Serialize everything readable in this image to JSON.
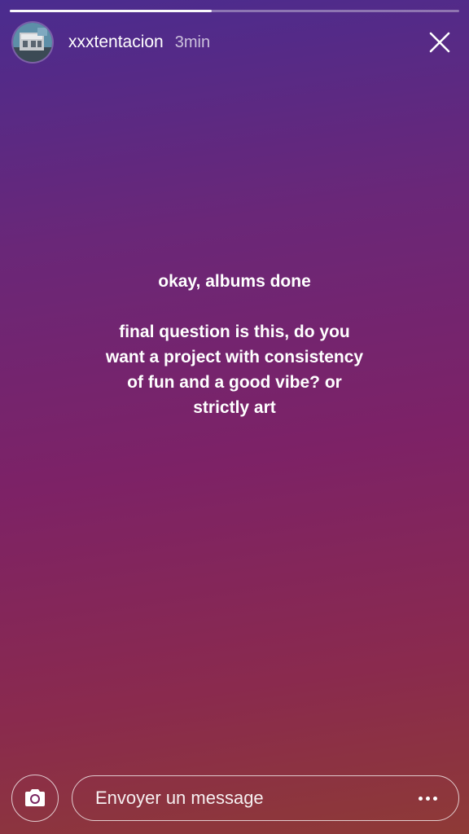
{
  "story": {
    "progress": 0.45,
    "header": {
      "username": "xxxtentacion",
      "timestamp": "3min",
      "avatar_icon": "profile-photo",
      "close_icon": "close-icon"
    },
    "text": {
      "line1": "okay, albums done",
      "line2": "final question is this, do you want a project with consistency of fun and a good vibe? or strictly art"
    }
  },
  "bottom_bar": {
    "camera_icon": "camera-icon",
    "message_placeholder": "Envoyer un message",
    "more_icon": "more-horizontal-icon"
  },
  "colors": {
    "gradient_top": "#4a2c8f",
    "gradient_mid": "#7d2266",
    "gradient_bottom": "#8e3a36",
    "text": "#ffffff"
  }
}
